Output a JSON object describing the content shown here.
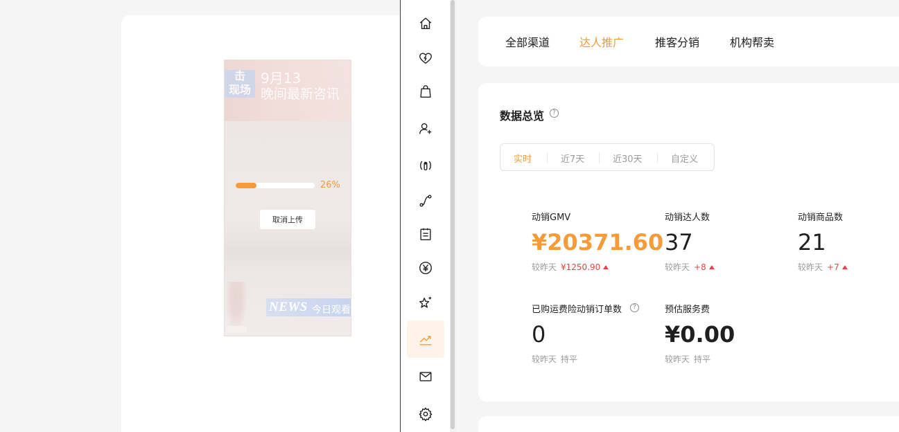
{
  "upload": {
    "overlay_date": "9月13",
    "overlay_headline": "晚间最新咨讯",
    "overlay_badge_top": "击",
    "overlay_badge_bottom": "现场",
    "overlay_news": "NEWS",
    "overlay_news_sub": "今日观看",
    "progress_fraction": 0.26,
    "progress_text": "26%",
    "cancel_label": "取消上传",
    "accent_color": "#f59b3a"
  },
  "rail": {
    "items": [
      {
        "icon": "home-icon"
      },
      {
        "icon": "heart-lightning-icon"
      },
      {
        "icon": "shopping-bag-icon"
      },
      {
        "icon": "user-sparkle-icon"
      },
      {
        "icon": "live-broadcast-icon"
      },
      {
        "icon": "route-icon"
      },
      {
        "icon": "clipboard-icon"
      },
      {
        "icon": "yen-coin-icon"
      },
      {
        "icon": "star-sparkle-icon"
      },
      {
        "icon": "trend-chart-icon",
        "active": true
      },
      {
        "icon": "mail-check-icon"
      },
      {
        "icon": "gear-icon"
      }
    ]
  },
  "tabs": {
    "items": [
      {
        "label": "全部渠道"
      },
      {
        "label": "达人推广",
        "active": true
      },
      {
        "label": "推客分销"
      },
      {
        "label": "机构帮卖"
      }
    ]
  },
  "overview": {
    "title": "数据总览",
    "help": "?",
    "ranges": [
      {
        "label": "实时",
        "active": true
      },
      {
        "label": "近7天"
      },
      {
        "label": "近30天"
      },
      {
        "label": "自定义"
      }
    ],
    "compare_label": "较昨天",
    "metrics": [
      {
        "label": "动销GMV",
        "value": "¥20371.60",
        "delta": "¥1250.90",
        "trend": "up"
      },
      {
        "label": "动销达人数",
        "value": "37",
        "delta": "+8",
        "trend": "up"
      },
      {
        "label": "动销商品数",
        "value": "21",
        "delta": "+7",
        "trend": "up"
      },
      {
        "label": "已购运费险动销订单数",
        "value": "0",
        "delta": "持平",
        "trend": "flat"
      },
      {
        "label": "预估服务费",
        "value": "¥0.00",
        "delta": "持平",
        "trend": "flat"
      }
    ],
    "colors": {
      "accent": "#f59b3a",
      "up": "#e04545",
      "muted": "#9b9b9b"
    }
  }
}
